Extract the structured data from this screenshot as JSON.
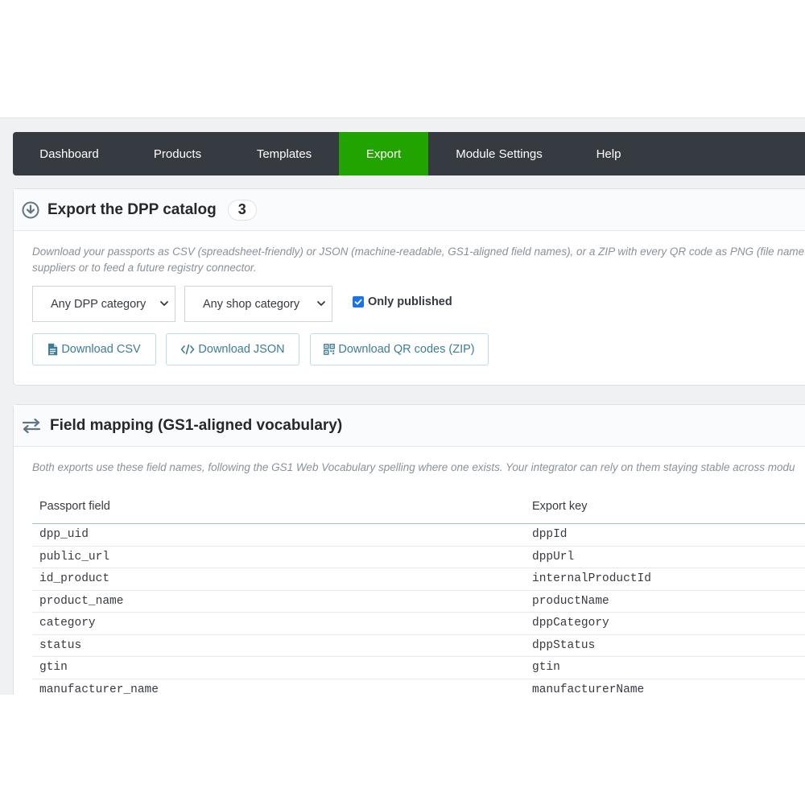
{
  "nav": {
    "items": [
      {
        "label": "Dashboard"
      },
      {
        "label": "Products"
      },
      {
        "label": "Templates"
      },
      {
        "label": "Export"
      },
      {
        "label": "Module Settings"
      },
      {
        "label": "Help"
      }
    ],
    "active_label": "Export",
    "active_color": "#21a400",
    "bg_color": "#363a41"
  },
  "export_panel": {
    "title": "Export the DPP catalog",
    "count": "3",
    "title_icon": "download-circle-icon",
    "help_line1": "Download your passports as CSV (spreadsheet-friendly) or JSON (machine-readable, GS1-aligned field names), or a ZIP with every QR code as PNG (file name =",
    "help_line2": "suppliers or to feed a future registry connector.",
    "filters": {
      "dpp_category": "Any DPP category",
      "shop_category": "Any shop category",
      "only_published_label": "Only published",
      "only_published_checked": true
    },
    "buttons": {
      "csv": "Download CSV",
      "json": "Download JSON",
      "qr": "Download QR codes (ZIP)"
    },
    "button_color": "#3d7d95"
  },
  "mapping_panel": {
    "title": "Field mapping (GS1-aligned vocabulary)",
    "title_icon": "exchange-arrows-icon",
    "help": "Both exports use these field names, following the GS1 Web Vocabulary spelling where one exists. Your integrator can rely on them staying stable across modu",
    "columns": [
      "Passport field",
      "Export key"
    ],
    "rows": [
      [
        "dpp_uid",
        "dppId"
      ],
      [
        "public_url",
        "dppUrl"
      ],
      [
        "id_product",
        "internalProductId"
      ],
      [
        "product_name",
        "productName"
      ],
      [
        "category",
        "dppCategory"
      ],
      [
        "status",
        "dppStatus"
      ],
      [
        "gtin",
        "gtin"
      ],
      [
        "manufacturer_name",
        "manufacturerName"
      ]
    ]
  }
}
